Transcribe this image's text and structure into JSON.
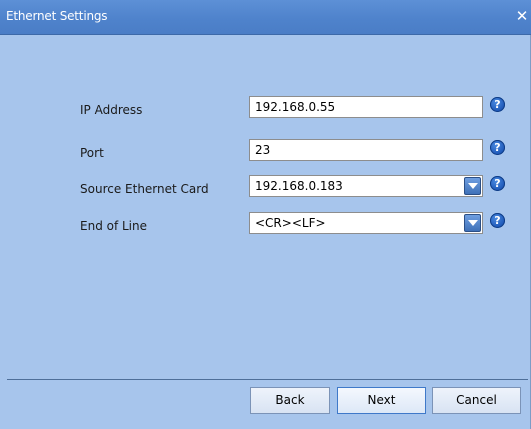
{
  "window": {
    "title": "Ethernet Settings",
    "close_glyph": "✕"
  },
  "form": {
    "rows": [
      {
        "label": "IP Address",
        "value": "192.168.0.55",
        "kind": "text"
      },
      {
        "label": "Port",
        "value": "23",
        "kind": "text"
      },
      {
        "label": "Source Ethernet Card",
        "value": "192.168.0.183",
        "kind": "select"
      },
      {
        "label": "End of Line",
        "value": "<CR><LF>",
        "kind": "select"
      }
    ],
    "help_glyph": "?"
  },
  "buttons": {
    "back": "Back",
    "next": "Next",
    "cancel": "Cancel"
  },
  "colors": {
    "window_bg": "#a7c5ec",
    "titlebar": "#4f83cc",
    "help_icon": "#1c56b6"
  },
  "icons": {
    "close": "close-icon",
    "help": "help-icon",
    "dropdown": "chevron-down-icon"
  }
}
